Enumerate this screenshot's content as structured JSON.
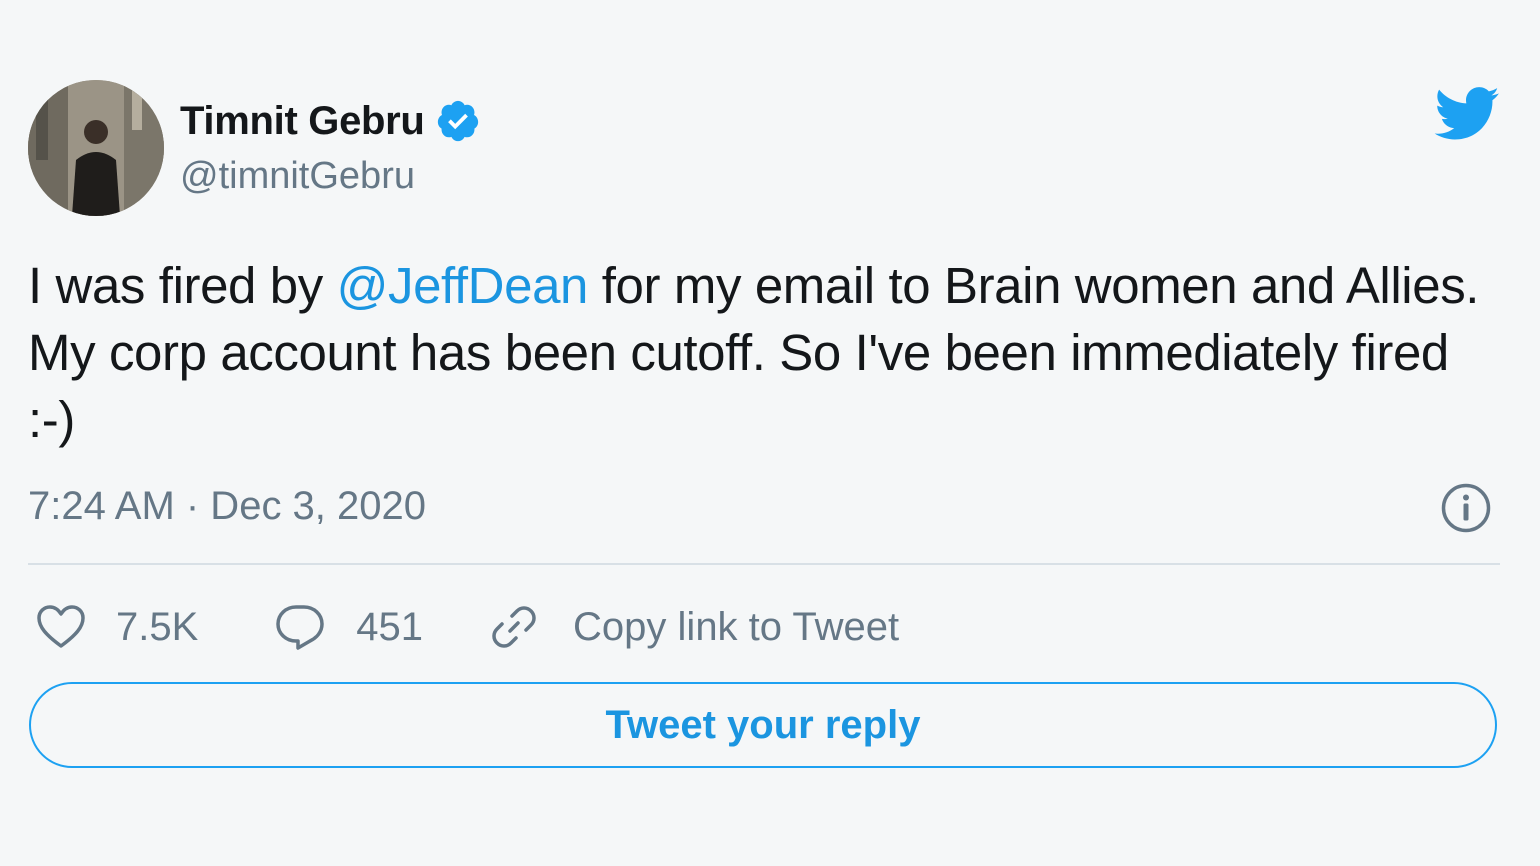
{
  "tweet": {
    "author_name": "Timnit Gebru",
    "author_handle": "@timnitGebru",
    "verified": true,
    "text_part1": "I was fired by ",
    "mention": "@JeffDean",
    "text_part2": " for my email to Brain women and Allies. My corp account has been cutoff. So I've been immediately fired :-)",
    "timestamp": "7:24 AM · Dec 3, 2020"
  },
  "actions": {
    "likes": "7.5K",
    "replies": "451",
    "copy_link_label": "Copy link to Tweet"
  },
  "reply_button_label": "Tweet your reply",
  "icons": {
    "brand": "twitter-bird-icon",
    "verified": "verified-badge-icon",
    "info": "info-icon",
    "like": "heart-icon",
    "reply": "speech-bubble-icon",
    "link": "link-icon"
  },
  "colors": {
    "accent": "#1da1f2",
    "mention": "#1b95e0",
    "text": "#14171a",
    "muted": "#657786",
    "background": "#f5f7f8"
  }
}
